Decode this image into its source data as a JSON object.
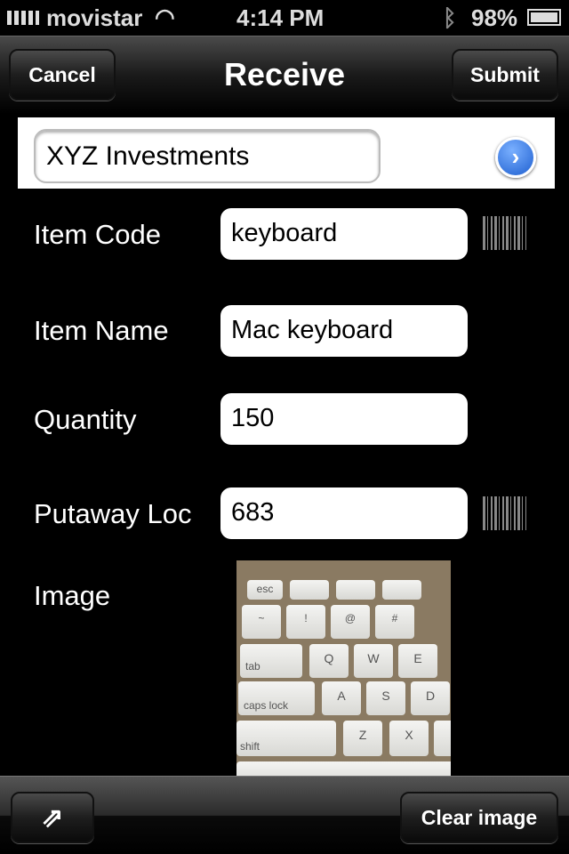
{
  "status_bar": {
    "carrier": "movistar",
    "time": "4:14 PM",
    "battery": "98%",
    "icons": [
      "signal-icon",
      "wifi-icon",
      "bluetooth-icon",
      "battery-icon"
    ]
  },
  "nav": {
    "title": "Receive",
    "cancel": "Cancel",
    "submit": "Submit"
  },
  "vendor": {
    "value": "XYZ Investments",
    "disclosure": "›"
  },
  "form": {
    "item_code": {
      "label": "Item Code",
      "value": "keyboard"
    },
    "item_name": {
      "label": "Item Name",
      "value": "Mac keyboard"
    },
    "quantity": {
      "label": "Quantity",
      "value": "150"
    },
    "putaway": {
      "label": "Putaway Loc",
      "value": "683"
    },
    "image": {
      "label": "Image",
      "keys": [
        "esc",
        "~",
        "!",
        "@",
        "#",
        "tab",
        "Q",
        "W",
        "E",
        "caps lock",
        "A",
        "S",
        "D",
        "shift",
        "Z",
        "X"
      ]
    }
  },
  "toolbar": {
    "clear_image": "Clear image"
  },
  "colors": {
    "accent": "#1e5fd0"
  }
}
